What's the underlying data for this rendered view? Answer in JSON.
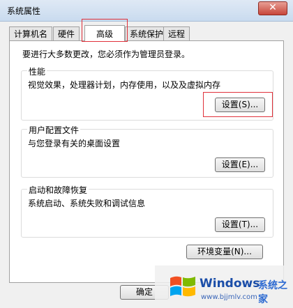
{
  "window": {
    "title": "系统属性",
    "close_glyph": "✕"
  },
  "tabs": [
    {
      "label": "计算机名"
    },
    {
      "label": "硬件"
    },
    {
      "label": "高级",
      "active": true
    },
    {
      "label": "系统保护"
    },
    {
      "label": "远程"
    }
  ],
  "admin_note": "要进行大多数更改，您必须作为管理员登录。",
  "groups": {
    "performance": {
      "title": "性能",
      "desc": "视觉效果，处理器计划，内存使用，以及及虚拟内存",
      "button": "设置(S)..."
    },
    "user_profiles": {
      "title": "用户配置文件",
      "desc": "与您登录有关的桌面设置",
      "button": "设置(E)..."
    },
    "startup_recovery": {
      "title": "启动和故障恢复",
      "desc": "系统启动、系统失败和调试信息",
      "button": "设置(T)..."
    }
  },
  "env_button": "环境变量(N)...",
  "footer": {
    "ok_button": "确定"
  },
  "watermark": {
    "brand": "Windows",
    "brand_cn": "系统之家",
    "url": "www.bjjmlv.com"
  },
  "colors": {
    "highlight": "#e0303a",
    "title_bg": "#dfe9f5",
    "watermark_blue": "#1a4da8"
  }
}
